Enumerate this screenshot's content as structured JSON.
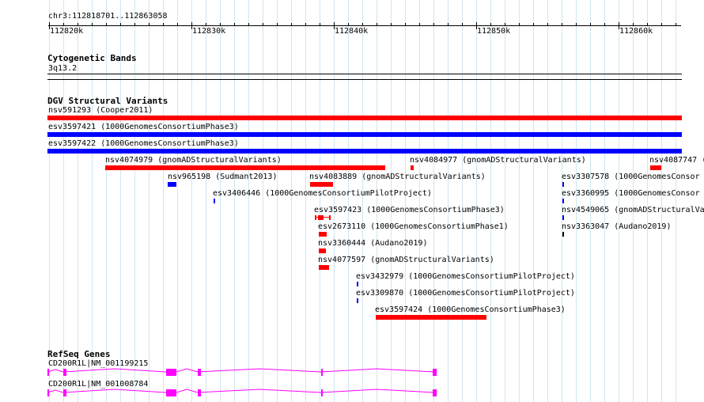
{
  "region": {
    "label": "chr3:112818701..112863058",
    "ruler_ticks": [
      "112820k",
      "112830k",
      "112840k",
      "112850k",
      "112860k"
    ]
  },
  "cytoband_track": {
    "title": "Cytogenetic Bands",
    "band": "3q13.2"
  },
  "dgv_track": {
    "title": "DGV Structural Variants",
    "colors": {
      "gain": "#ff0000",
      "loss": "#0000ff",
      "complex": "#0000ff"
    },
    "features": [
      {
        "label": "nsv591293 (Cooper2011)",
        "color": "red"
      },
      {
        "label": "esv3597421 (1000GenomesConsortiumPhase3)",
        "color": "blue"
      },
      {
        "label": "esv3597422 (1000GenomesConsortiumPhase3)",
        "color": "blue"
      },
      {
        "label": "nsv4074979 (gnomADStructuralVariants)",
        "color": "red"
      },
      {
        "label": "nsv4084977 (gnomADStructuralVariants)",
        "color": "red"
      },
      {
        "label": "nsv4087747 (",
        "color": "red"
      },
      {
        "label": "nsv965198 (Sudmant2013)",
        "color": "blue"
      },
      {
        "label": "nsv4083889 (gnomADStructuralVariants)",
        "color": "red"
      },
      {
        "label": "esv3307578 (1000GenomesConsor",
        "color": "blue"
      },
      {
        "label": "esv3406446 (1000GenomesConsortiumPilotProject)",
        "color": "blue"
      },
      {
        "label": "esv3360995 (1000GenomesConsor",
        "color": "blue"
      },
      {
        "label": "esv3597423 (1000GenomesConsortiumPhase3)",
        "color": "red"
      },
      {
        "label": "nsv4549065 (gnomADStructuralVa",
        "color": "blue"
      },
      {
        "label": "esv2673110 (1000GenomesConsortiumPhase1)",
        "color": "red"
      },
      {
        "label": "nsv3363047 (Audano2019)",
        "color": "black"
      },
      {
        "label": "nsv3360444 (Audano2019)",
        "color": "red"
      },
      {
        "label": "nsv4077597 (gnomADStructuralVariants)",
        "color": "red"
      },
      {
        "label": "esv3432979 (1000GenomesConsortiumPilotProject)",
        "color": "blue"
      },
      {
        "label": "esv3309870 (1000GenomesConsortiumPilotProject)",
        "color": "blue"
      },
      {
        "label": "esv3597424 (1000GenomesConsortiumPhase3)",
        "color": "red"
      }
    ]
  },
  "refseq_track": {
    "title": "RefSeq Genes",
    "color": "#ff00ff",
    "transcripts": [
      {
        "label": "CD200R1L|NM_001199215"
      },
      {
        "label": "CD200R1L|NM_001008784"
      }
    ]
  }
}
